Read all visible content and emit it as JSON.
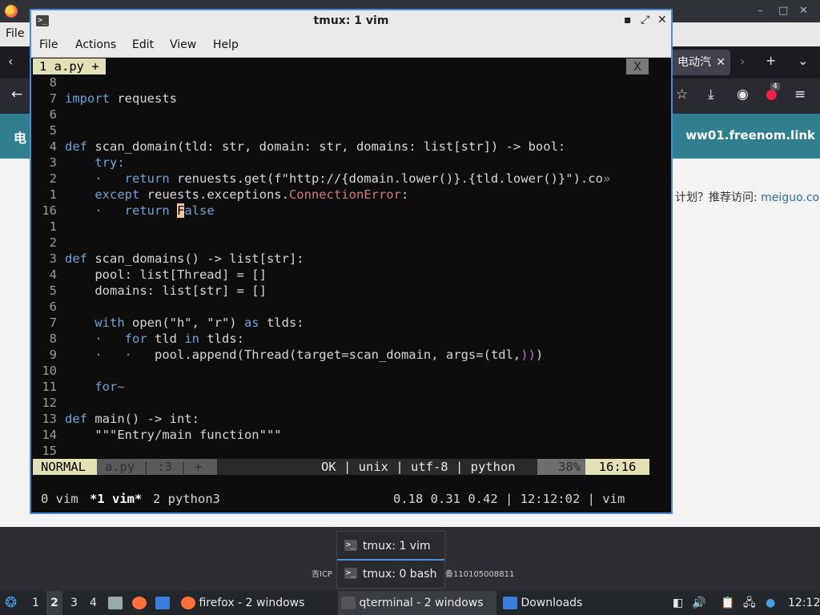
{
  "firefox": {
    "menu_file": "File",
    "tab_title": "电动汽",
    "site_header_left": "电",
    "site_header_right": "ww01.freenom.link",
    "site_text_prefix": "计划？推荐访问: ",
    "site_text_link": "meiguo.com",
    "footer_left": "吉ICP",
    "footer_right": "备110105008811"
  },
  "terminal": {
    "window_title": "tmux: 1 vim",
    "menu": [
      "File",
      "Actions",
      "Edit",
      "View",
      "Help"
    ],
    "vim_tab": "1 a.py +",
    "vim_tab_close": "X",
    "status": {
      "mode": "NORMAL",
      "file": "a.py | :3 | +",
      "info": "OK | unix | utf-8 | python",
      "percent": "38%",
      "position": "16:16"
    },
    "tmux": {
      "w0": "0 vim",
      "w1": "*1 vim*",
      "w2": "2 python3",
      "right": "0.18 0.31 0.42 | 12:12:02 | vim"
    }
  },
  "code_lines": [
    {
      "n": "8",
      "segs": []
    },
    {
      "n": "7",
      "segs": [
        {
          "t": "import",
          "c": "kw"
        },
        {
          "t": " requests",
          "c": ""
        }
      ]
    },
    {
      "n": "6",
      "segs": []
    },
    {
      "n": "5",
      "segs": []
    },
    {
      "n": "4",
      "segs": [
        {
          "t": "def",
          "c": "kw"
        },
        {
          "t": " scan_domain(tld: str, domain: str, domains: list[str]) -> bool:",
          "c": ""
        }
      ]
    },
    {
      "n": "3",
      "segs": [
        {
          "t": "    try:",
          "c": "kw"
        }
      ]
    },
    {
      "n": "2",
      "segs": [
        {
          "t": "    · ",
          "c": "grey"
        },
        {
          "t": "  return",
          "c": "kw"
        },
        {
          "t": " renuests.get(f\"http://{domain.lower()}.{tld.lower()}\").co",
          "c": ""
        },
        {
          "t": "»",
          "c": "grey"
        }
      ]
    },
    {
      "n": "1",
      "segs": [
        {
          "t": "    except",
          "c": "kw"
        },
        {
          "t": " reuests.exceptions.",
          "c": ""
        },
        {
          "t": "ConnectionError",
          "c": "red"
        },
        {
          "t": ":",
          "c": ""
        }
      ]
    },
    {
      "n": "16",
      "segs": [
        {
          "t": "    · ",
          "c": "grey"
        },
        {
          "t": "  return",
          "c": "kw"
        },
        {
          "t": " ",
          "c": ""
        },
        {
          "t": "F",
          "c": "cursor"
        },
        {
          "t": "alse",
          "c": "kw"
        }
      ]
    },
    {
      "n": "1",
      "segs": []
    },
    {
      "n": "2",
      "segs": []
    },
    {
      "n": "3",
      "segs": [
        {
          "t": "def",
          "c": "kw"
        },
        {
          "t": " scan_domains() -> list[str]:",
          "c": ""
        }
      ]
    },
    {
      "n": "4",
      "segs": [
        {
          "t": "    pool: list[Thread] = []",
          "c": ""
        }
      ]
    },
    {
      "n": "5",
      "segs": [
        {
          "t": "    domains: list[str] = []",
          "c": ""
        }
      ]
    },
    {
      "n": "6",
      "segs": []
    },
    {
      "n": "7",
      "segs": [
        {
          "t": "    with",
          "c": "kw"
        },
        {
          "t": " open(\"h\", \"r\") ",
          "c": ""
        },
        {
          "t": "as",
          "c": "kw"
        },
        {
          "t": " tlds:",
          "c": ""
        }
      ]
    },
    {
      "n": "8",
      "segs": [
        {
          "t": "    · ",
          "c": "grey"
        },
        {
          "t": "  for",
          "c": "kw"
        },
        {
          "t": " tld ",
          "c": ""
        },
        {
          "t": "in",
          "c": "kw"
        },
        {
          "t": " tlds:",
          "c": ""
        }
      ]
    },
    {
      "n": "9",
      "segs": [
        {
          "t": "    · ",
          "c": "grey"
        },
        {
          "t": "  · ",
          "c": "grey"
        },
        {
          "t": "  pool.append(Thread(",
          "c": ""
        },
        {
          "t": "target=scan_domain, args=(",
          "c": ""
        },
        {
          "t": "tdl,",
          "c": ""
        },
        {
          "t": "))",
          "c": "pur"
        },
        {
          "t": ")",
          "c": ""
        }
      ]
    },
    {
      "n": "10",
      "segs": []
    },
    {
      "n": "11",
      "segs": [
        {
          "t": "    for",
          "c": "kw"
        },
        {
          "t": "~",
          "c": "grey"
        }
      ]
    },
    {
      "n": "12",
      "segs": []
    },
    {
      "n": "13",
      "segs": [
        {
          "t": "def",
          "c": "kw"
        },
        {
          "t": " main() -> int:",
          "c": ""
        }
      ]
    },
    {
      "n": "14",
      "segs": [
        {
          "t": "    \"\"\"Entry/main function\"\"\"",
          "c": ""
        }
      ]
    },
    {
      "n": "15",
      "segs": []
    }
  ],
  "popup": {
    "items": [
      "tmux: 1 vim",
      "tmux: 0 bash"
    ]
  },
  "taskbar": {
    "workspaces": [
      "1",
      "2",
      "3",
      "4"
    ],
    "firefox": "firefox - 2 windows",
    "qterminal": "qterminal - 2 windows",
    "downloads": "Downloads",
    "clock": "12:12"
  }
}
